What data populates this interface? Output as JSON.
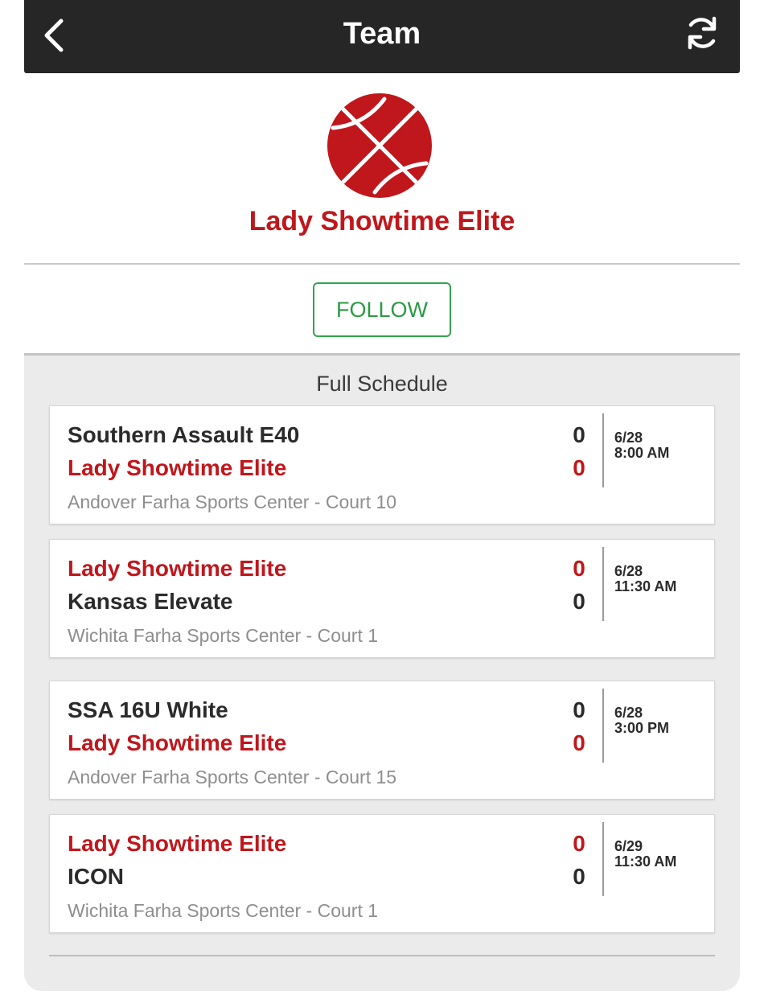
{
  "header": {
    "title": "Team",
    "back_icon": "chevron-left-icon",
    "refresh_icon": "refresh-icon"
  },
  "team": {
    "name": "Lady Showtime Elite",
    "logo_icon": "basketball-icon",
    "logo_color": "#c0171c"
  },
  "follow": {
    "label": "FOLLOW",
    "color": "#2a9a44"
  },
  "schedule": {
    "title": "Full Schedule",
    "games": [
      {
        "team1": "Southern Assault E40",
        "score1": "0",
        "team2": "Lady Showtime Elite",
        "score2": "0",
        "date": "6/28",
        "time": "8:00 AM",
        "venue": "Andover Farha Sports Center - Court 10"
      },
      {
        "team1": "Lady Showtime Elite",
        "score1": "0",
        "team2": "Kansas Elevate",
        "score2": "0",
        "date": "6/28",
        "time": "11:30 AM",
        "venue": "Wichita Farha Sports Center - Court 1"
      },
      {
        "team1": "SSA 16U White",
        "score1": "0",
        "team2": "Lady Showtime Elite",
        "score2": "0",
        "date": "6/28",
        "time": "3:00 PM",
        "venue": "Andover Farha Sports Center - Court 15"
      },
      {
        "team1": "Lady Showtime Elite",
        "score1": "0",
        "team2": "ICON",
        "score2": "0",
        "date": "6/29",
        "time": "11:30 AM",
        "venue": "Wichita Farha Sports Center - Court 1"
      }
    ]
  }
}
